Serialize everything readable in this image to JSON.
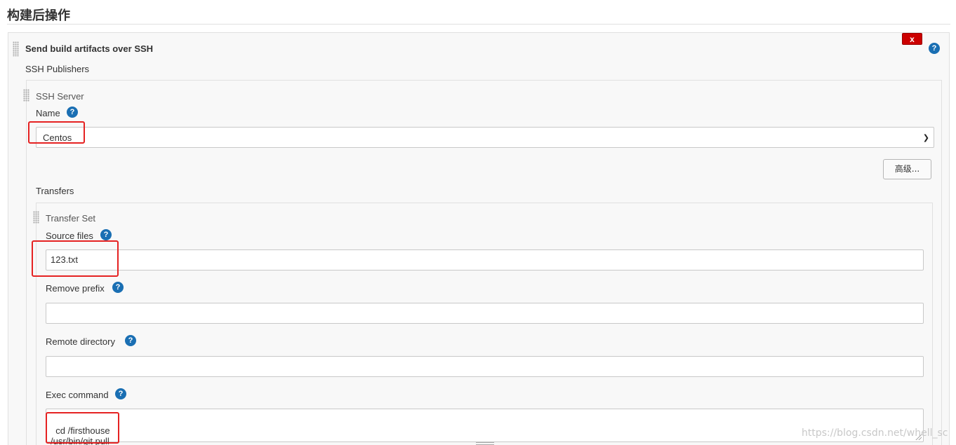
{
  "section": {
    "title": "构建后操作"
  },
  "publisher": {
    "heading": "Send build artifacts over SSH",
    "delete_label": "x",
    "help_symbol": "?",
    "ssh_publishers_label": "SSH Publishers"
  },
  "ssh_server": {
    "heading": "SSH Server",
    "name_label": "Name",
    "name_value": "Centos",
    "advanced_label": "高级...",
    "transfers_label": "Transfers"
  },
  "transfer_set": {
    "heading": "Transfer Set",
    "source_files_label": "Source files",
    "source_files_value": "123.txt",
    "remove_prefix_label": "Remove prefix",
    "remove_prefix_value": "",
    "remote_directory_label": "Remote directory",
    "remote_directory_value": "",
    "exec_command_label": "Exec command",
    "exec_command_value": "cd /firsthouse\n/usr/bin/git pull"
  },
  "watermark": "https://blog.csdn.net/whell_sc",
  "colors": {
    "help_icon": "#1a6fb3",
    "delete_button": "#cc0000",
    "annotation_box": "#e52222"
  }
}
